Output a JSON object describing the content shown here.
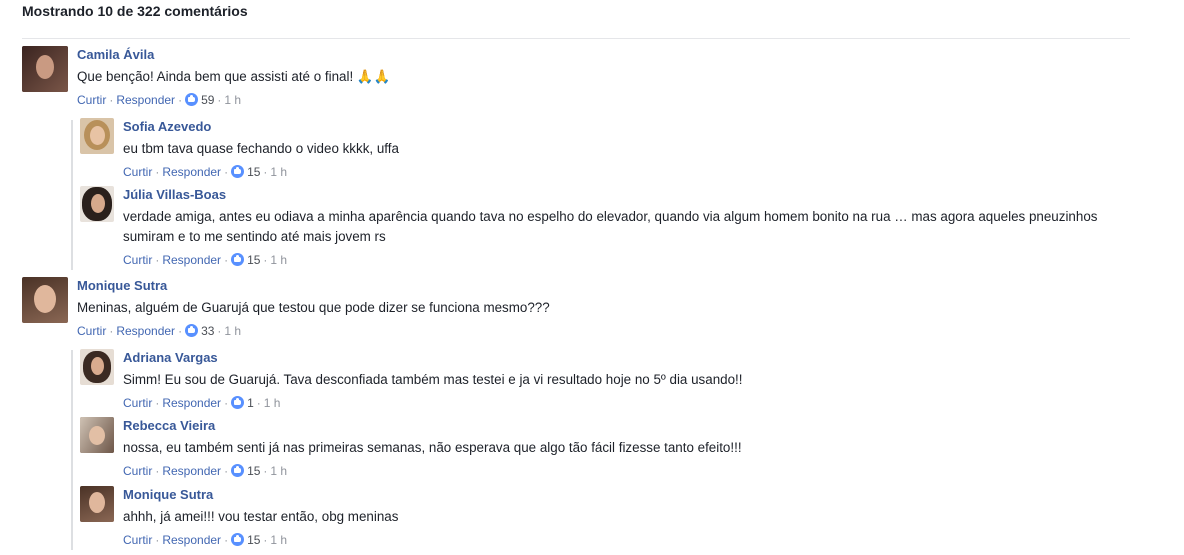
{
  "header": {
    "title": "Mostrando 10 de 322 comentários"
  },
  "labels": {
    "like": "Curtir",
    "reply": "Responder",
    "dot": "·"
  },
  "colors": {
    "name": "#385898",
    "link": "#4267b2",
    "meta": "#90949c",
    "like_badge": "#5890ff"
  },
  "comments": [
    {
      "name": "Camila Ávila",
      "text": "Que benção! Ainda bem que assisti até o final! 🙏🙏",
      "likes": "59",
      "time": "1 h",
      "replies": [
        {
          "name": "Sofia Azevedo",
          "text": "eu tbm tava quase fechando o video kkkk, uffa",
          "likes": "15",
          "time": "1 h"
        },
        {
          "name": "Júlia Villas-Boas",
          "text": "verdade amiga, antes eu odiava a minha aparência quando tava no espelho do elevador, quando via algum homem bonito na rua … mas agora aqueles pneuzinhos sumiram e to me sentindo até mais jovem rs",
          "likes": "15",
          "time": "1 h"
        }
      ]
    },
    {
      "name": "Monique Sutra",
      "text": "Meninas, alguém de Guarujá que testou que pode dizer se funciona mesmo???",
      "likes": "33",
      "time": "1 h",
      "replies": [
        {
          "name": "Adriana Vargas",
          "text": "Simm! Eu sou de Guarujá. Tava desconfiada também mas testei e ja vi resultado hoje no 5º dia usando!!",
          "likes": "1",
          "time": "1 h"
        },
        {
          "name": "Rebecca Vieira",
          "text": "nossa, eu também senti já nas primeiras semanas, não esperava que algo tão fácil fizesse tanto efeito!!!",
          "likes": "15",
          "time": "1 h"
        },
        {
          "name": "Monique Sutra",
          "text": "ahhh, já amei!!! vou testar então, obg meninas",
          "likes": "15",
          "time": "1 h"
        }
      ]
    }
  ]
}
